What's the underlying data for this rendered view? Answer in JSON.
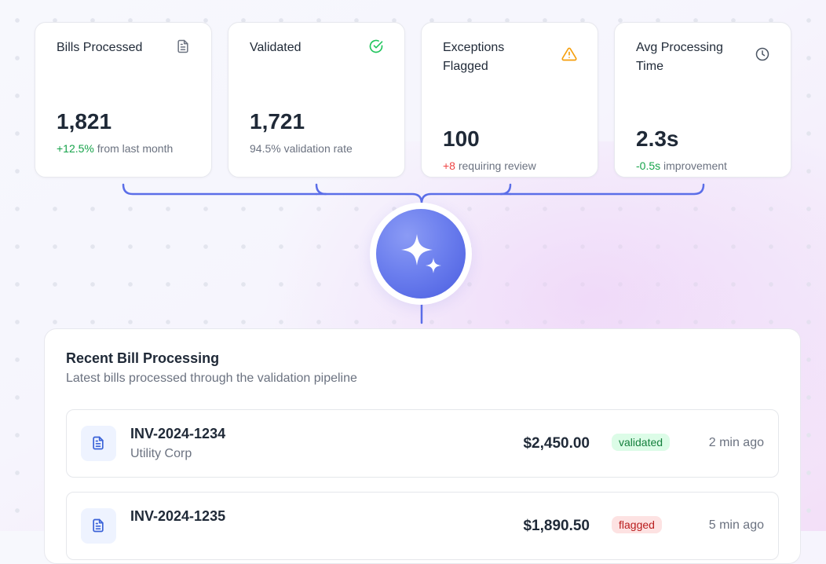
{
  "stats": [
    {
      "title": "Bills Processed",
      "icon": "document-icon",
      "value": "1,821",
      "delta": "+12.5%",
      "note": "from last month",
      "delta_color": "#16a34a"
    },
    {
      "title": "Validated",
      "icon": "check-circle-icon",
      "value": "1,721",
      "delta": "",
      "note": "94.5% validation rate",
      "icon_color": "#22c55e"
    },
    {
      "title": "Exceptions Flagged",
      "icon": "warning-triangle-icon",
      "value": "100",
      "delta": "+8",
      "note": "requiring review",
      "delta_color": "#ef4444",
      "icon_color": "#f59e0b"
    },
    {
      "title": "Avg Processing Time",
      "icon": "clock-icon",
      "value": "2.3s",
      "delta": "-0.5s",
      "note": "improvement",
      "delta_color": "#16a34a"
    }
  ],
  "hub": {
    "icon": "sparkles-icon",
    "accent": "#5b6ee8"
  },
  "recent": {
    "title": "Recent Bill Processing",
    "description": "Latest bills processed through the validation pipeline",
    "rows": [
      {
        "invoice": "INV-2024-1234",
        "vendor": "Utility Corp",
        "amount": "$2,450.00",
        "status": "validated",
        "time": "2 min ago"
      },
      {
        "invoice": "INV-2024-1235",
        "vendor": "",
        "amount": "$1,890.50",
        "status": "flagged",
        "time": "5 min ago"
      }
    ]
  }
}
